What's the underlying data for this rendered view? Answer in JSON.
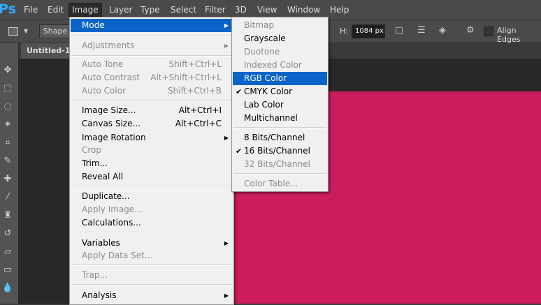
{
  "app": {
    "logo": "Ps"
  },
  "menubar": {
    "items": [
      "File",
      "Edit",
      "Image",
      "Layer",
      "Type",
      "Select",
      "Filter",
      "3D",
      "View",
      "Window",
      "Help"
    ],
    "active": "Image"
  },
  "options": {
    "mode": "Shape",
    "h_label": "H:",
    "h_value": "1084 px",
    "align_edges": "Align Edges",
    "align_edges_checked": false
  },
  "document": {
    "tab_title": "Untitled-1 @"
  },
  "canvas": {
    "fill_color": "#cc1c5e"
  },
  "image_menu": {
    "items": [
      {
        "label": "Mode",
        "submenu": true,
        "highlighted": true
      },
      {
        "label": "Adjustments",
        "submenu": true,
        "disabled": true
      },
      {
        "label": "Auto Tone",
        "shortcut": "Shift+Ctrl+L",
        "disabled": true
      },
      {
        "label": "Auto Contrast",
        "shortcut": "Alt+Shift+Ctrl+L",
        "disabled": true
      },
      {
        "label": "Auto Color",
        "shortcut": "Shift+Ctrl+B",
        "disabled": true
      },
      {
        "label": "Image Size...",
        "shortcut": "Alt+Ctrl+I"
      },
      {
        "label": "Canvas Size...",
        "shortcut": "Alt+Ctrl+C"
      },
      {
        "label": "Image Rotation",
        "submenu": true
      },
      {
        "label": "Crop",
        "disabled": true
      },
      {
        "label": "Trim..."
      },
      {
        "label": "Reveal All"
      },
      {
        "label": "Duplicate..."
      },
      {
        "label": "Apply Image...",
        "disabled": true
      },
      {
        "label": "Calculations..."
      },
      {
        "label": "Variables",
        "submenu": true
      },
      {
        "label": "Apply Data Set...",
        "disabled": true
      },
      {
        "label": "Trap...",
        "disabled": true
      },
      {
        "label": "Analysis",
        "submenu": true
      }
    ]
  },
  "mode_submenu": {
    "items": [
      {
        "label": "Bitmap",
        "disabled": true
      },
      {
        "label": "Grayscale"
      },
      {
        "label": "Duotone",
        "disabled": true
      },
      {
        "label": "Indexed Color",
        "disabled": true
      },
      {
        "label": "RGB Color",
        "highlighted": true
      },
      {
        "label": "CMYK Color",
        "checked": true
      },
      {
        "label": "Lab Color"
      },
      {
        "label": "Multichannel"
      },
      {
        "label": "8 Bits/Channel"
      },
      {
        "label": "16 Bits/Channel",
        "checked": true
      },
      {
        "label": "32 Bits/Channel",
        "disabled": true
      },
      {
        "label": "Color Table...",
        "disabled": true
      }
    ],
    "check_glyph": "✔"
  },
  "icons": {
    "submenu_arrow": "▶",
    "dropdown_caret": "▼"
  }
}
